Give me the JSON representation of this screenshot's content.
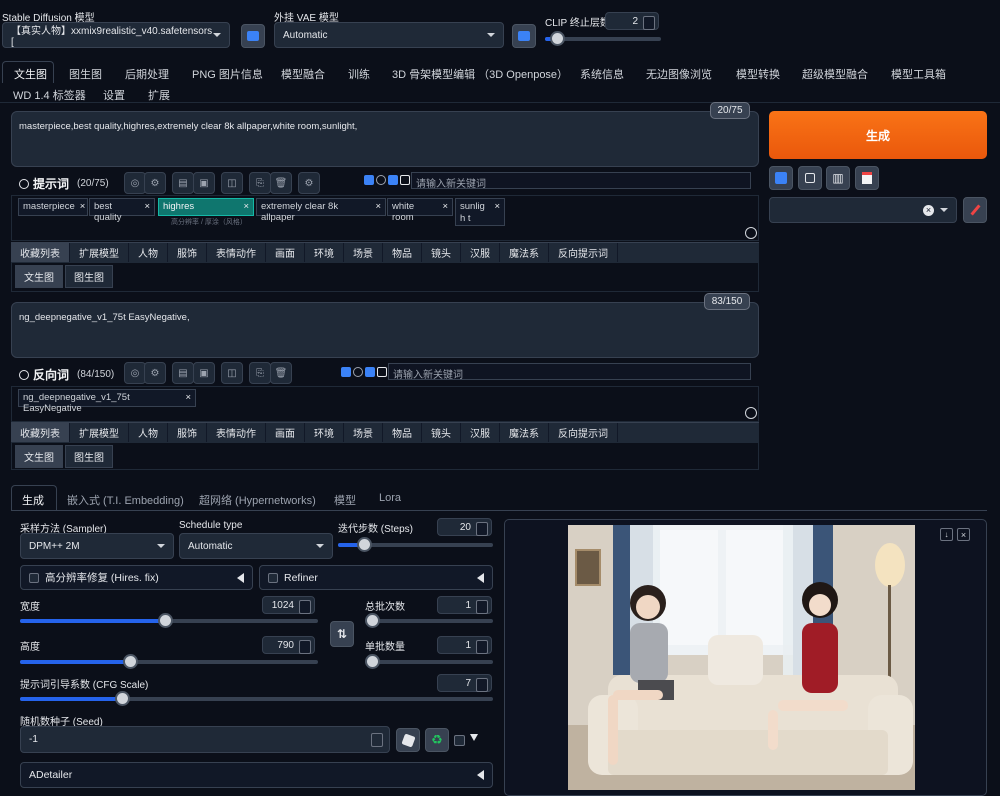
{
  "header": {
    "sd_model_label": "Stable Diffusion 模型",
    "sd_model_value": "【真实人物】xxmix9realistic_v40.safetensors [",
    "vae_label": "外挂 VAE 模型",
    "vae_value": "Automatic",
    "clip_label": "CLIP 终止层数",
    "clip_value": "2",
    "clip_level": 0.1
  },
  "main_tabs_row1": [
    "文生图",
    "图生图",
    "后期处理",
    "PNG 图片信息",
    "模型融合",
    "训练",
    "3D 骨架模型编辑 （3D Openpose）",
    "系统信息",
    "无边图像浏览",
    "模型转换",
    "超级模型融合",
    "模型工具箱"
  ],
  "main_tabs_row2": [
    "WD 1.4 标签器",
    "设置",
    "扩展"
  ],
  "prompt": {
    "text": "masterpiece,best quality,highres,extremely clear 8k allpaper,white room,sunlight,",
    "counter": "20/75",
    "title": "提示词",
    "count": "(20/75)",
    "keyword_placeholder": "请输入新关键词",
    "tags": [
      "masterpiece",
      "best quality",
      "highres",
      "extremely clear 8k allpaper",
      "white room",
      "sunligh t"
    ],
    "highres_hint": "高分辨率 / 厚涂（风格）"
  },
  "negative": {
    "text": "ng_deepnegative_v1_75t EasyNegative,",
    "counter": "83/150",
    "title": "反向词",
    "count": "(84/150)",
    "keyword_placeholder": "请输入新关键词",
    "tags": [
      "ng_deepnegative_v1_75t EasyNegative"
    ]
  },
  "category_tabs": [
    "收藏列表",
    "扩展模型",
    "人物",
    "服饰",
    "表情动作",
    "画面",
    "环境",
    "场景",
    "物品",
    "镜头",
    "汉服",
    "魔法系",
    "反向提示词"
  ],
  "sub_tabs": [
    "文生图",
    "图生图"
  ],
  "generate_label": "生成",
  "gen_tabs": [
    "生成",
    "嵌入式 (T.I. Embedding)",
    "超网络 (Hypernetworks)",
    "模型",
    "Lora"
  ],
  "sampler": {
    "label": "采样方法 (Sampler)",
    "value": "DPM++ 2M"
  },
  "schedule": {
    "label": "Schedule type",
    "value": "Automatic"
  },
  "steps": {
    "label": "迭代步数 (Steps)",
    "value": "20"
  },
  "hires_label": "高分辨率修复 (Hires. fix)",
  "refiner_label": "Refiner",
  "width": {
    "label": "宽度",
    "value": "1024"
  },
  "height": {
    "label": "高度",
    "value": "790"
  },
  "batch_count": {
    "label": "总批次数",
    "value": "1"
  },
  "batch_size": {
    "label": "单批数量",
    "value": "1"
  },
  "cfg": {
    "label": "提示词引导系数 (CFG Scale)",
    "value": "7"
  },
  "seed": {
    "label": "随机数种子 (Seed)",
    "value": "-1"
  },
  "adetailer_label": "ADetailer",
  "colors": {
    "accent": "#ea580c",
    "bg": "#0b0f19",
    "blue": "#2563eb"
  }
}
